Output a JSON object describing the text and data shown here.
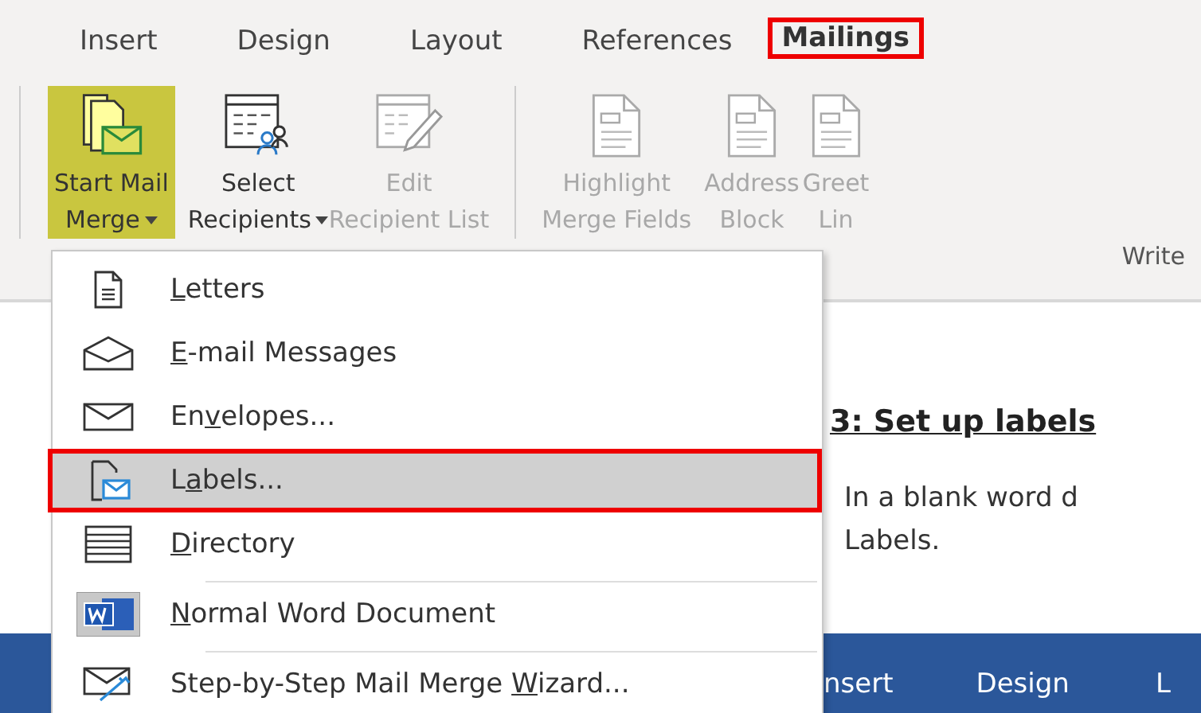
{
  "tabs": [
    {
      "label": "Insert",
      "annotated": false
    },
    {
      "label": "Design",
      "annotated": false
    },
    {
      "label": "Layout",
      "annotated": false
    },
    {
      "label": "References",
      "annotated": false
    },
    {
      "label": "Mailings",
      "annotated": true
    }
  ],
  "ribbon": {
    "buttons": [
      {
        "lines": [
          "Start Mail",
          "Merge"
        ],
        "has_menu": true,
        "disabled": false,
        "pressed": true
      },
      {
        "lines": [
          "Select",
          "Recipients"
        ],
        "has_menu": true,
        "disabled": false,
        "pressed": false
      },
      {
        "lines": [
          "Edit",
          "Recipient List"
        ],
        "has_menu": false,
        "disabled": true,
        "pressed": false
      },
      {
        "lines": [
          "Highlight",
          "Merge Fields"
        ],
        "has_menu": false,
        "disabled": true,
        "pressed": false
      },
      {
        "lines": [
          "Address",
          "Block"
        ],
        "has_menu": false,
        "disabled": true,
        "pressed": false
      },
      {
        "lines": [
          "Greet",
          "Lin"
        ],
        "has_menu": false,
        "disabled": true,
        "pressed": false
      }
    ],
    "group_label": "Write"
  },
  "menu": {
    "items": [
      {
        "label": {
          "key": "L",
          "after": "etters"
        },
        "selected": false,
        "annotated": false,
        "separator_before": false
      },
      {
        "label": {
          "key": "E",
          "after": "-mail Messages"
        },
        "selected": false,
        "annotated": false,
        "separator_before": false
      },
      {
        "label": {
          "before": "En",
          "key": "v",
          "after": "elopes..."
        },
        "selected": false,
        "annotated": false,
        "separator_before": false
      },
      {
        "label": {
          "before": "L",
          "key": "a",
          "after": "bels..."
        },
        "selected": true,
        "annotated": true,
        "separator_before": false
      },
      {
        "label": {
          "key": "D",
          "after": "irectory"
        },
        "selected": false,
        "annotated": false,
        "separator_before": false
      },
      {
        "label": {
          "key": "N",
          "after": "ormal Word Document"
        },
        "selected": false,
        "annotated": false,
        "separator_before": true
      },
      {
        "label": {
          "before": "Step-by-Step Mail Merge ",
          "key": "W",
          "after": "izard..."
        },
        "selected": false,
        "annotated": false,
        "separator_before": true
      }
    ]
  },
  "document": {
    "heading": "3: Set up labels",
    "paragraph_lines": [
      "In a blank word d",
      "Labels."
    ]
  },
  "inner_ribbon": {
    "tabs": [
      "nsert",
      "Design",
      "L"
    ]
  }
}
